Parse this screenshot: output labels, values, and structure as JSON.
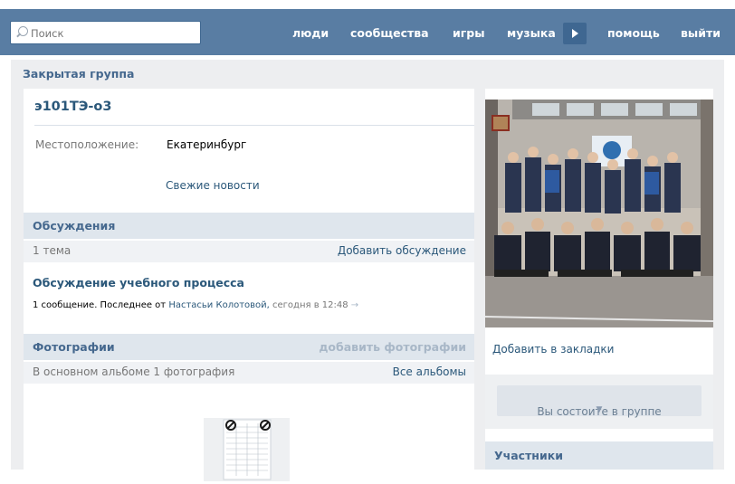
{
  "header": {
    "search_placeholder": "Поиск",
    "nav": [
      "люди",
      "сообщества",
      "игры",
      "музыка",
      "помощь",
      "выйти"
    ]
  },
  "group": {
    "type_label": "Закрытая группа",
    "name": "э101ТЭ-о3",
    "location_label": "Местоположение:",
    "location_value": "Екатеринбург",
    "fresh_news": "Свежие новости"
  },
  "discussions": {
    "title": "Обсуждения",
    "count": "1 тема",
    "add": "Добавить обсуждение",
    "topic_title": "Обсуждение учебного процесса",
    "topic_meta_prefix": "1 сообщение. Последнее от",
    "topic_meta_author": "Настасьи Колотовой,",
    "topic_meta_time": "сегодня в 12:48",
    "topic_meta_arrow": "→"
  },
  "photos": {
    "title": "Фотографии",
    "add": "добавить фотографии",
    "album_info": "В основном альбоме 1 фотография",
    "all_albums": "Все альбомы"
  },
  "sidebar": {
    "bookmark": "Добавить в закладки",
    "join_status": "Вы состоите в группе",
    "members_title": "Участники"
  },
  "colors": {
    "header_bg": "#597da3",
    "link": "#2b587a",
    "section_header": "#dfe6ed"
  }
}
